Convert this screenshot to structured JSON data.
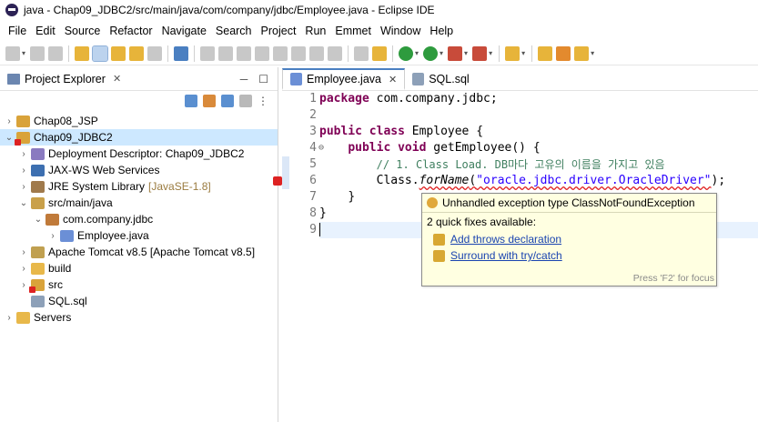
{
  "window": {
    "title": "java - Chap09_JDBC2/src/main/java/com/company/jdbc/Employee.java - Eclipse IDE"
  },
  "menu": [
    "File",
    "Edit",
    "Source",
    "Refactor",
    "Navigate",
    "Search",
    "Project",
    "Run",
    "Emmet",
    "Window",
    "Help"
  ],
  "explorer": {
    "tab_label": "Project Explorer",
    "items": [
      {
        "label": "Chap08_JSP"
      },
      {
        "label": "Chap09_JDBC2"
      },
      {
        "label": "Deployment Descriptor: Chap09_JDBC2"
      },
      {
        "label": "JAX-WS Web Services"
      },
      {
        "label": "JRE System Library",
        "suffix": "[JavaSE-1.8]"
      },
      {
        "label": "src/main/java"
      },
      {
        "label": "com.company.jdbc"
      },
      {
        "label": "Employee.java"
      },
      {
        "label": "Apache Tomcat v8.5 [Apache Tomcat v8.5]"
      },
      {
        "label": "build"
      },
      {
        "label": "src"
      },
      {
        "label": "SQL.sql"
      },
      {
        "label": "Servers"
      }
    ]
  },
  "editor": {
    "tabs": [
      {
        "label": "Employee.java"
      },
      {
        "label": "SQL.sql"
      }
    ],
    "line_numbers": [
      "1",
      "2",
      "3",
      "4",
      "5",
      "6",
      "7",
      "8",
      "9"
    ],
    "code": {
      "l1_kw": "package",
      "l1_rest": " com.company.jdbc;",
      "l3_kw1": "public",
      "l3_kw2": "class",
      "l3_rest": " Employee {",
      "l4_kw1": "public",
      "l4_kw2": "void",
      "l4_rest": " getEmployee() {",
      "l5_comment": "// 1. Class Load. DB마다 고유의 이름을 가지고 있음",
      "l6_class": "Class.",
      "l6_method": "forName",
      "l6_open": "(",
      "l6_string": "\"oracle.jdbc.driver.OracleDriver\"",
      "l6_close": ");",
      "l7": "}",
      "l8": "}"
    }
  },
  "quickfix": {
    "header": "Unhandled exception type ClassNotFoundException",
    "subheader": "2 quick fixes available:",
    "fixes": [
      "Add throws declaration",
      "Surround with try/catch"
    ],
    "footer": "Press 'F2' for focus"
  }
}
